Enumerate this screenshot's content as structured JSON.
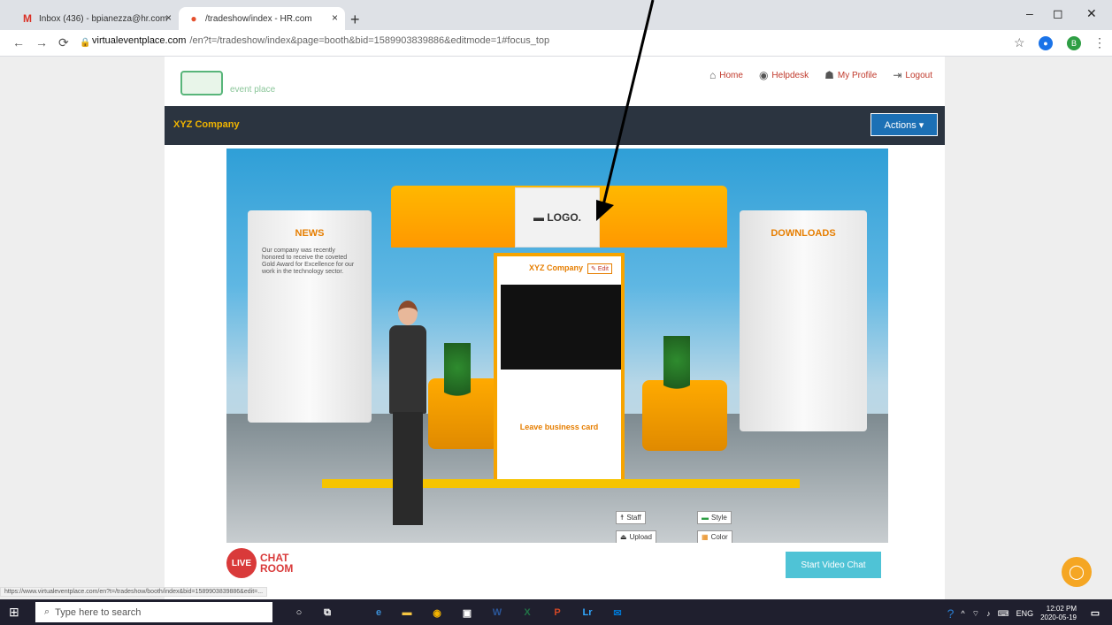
{
  "browser": {
    "tabs": [
      {
        "favicon": "M",
        "title": "Inbox (436) - bpianezza@hr.com",
        "close": "×"
      },
      {
        "favicon": "●",
        "title": "/tradeshow/index - HR.com",
        "close": "×"
      }
    ],
    "new_tab": "+",
    "window_controls": {
      "minimize": "–",
      "maximize": "◻",
      "close": "✕"
    },
    "url_host": "virtualeventplace.com",
    "url_path": "/en?t=/tradeshow/index&page=booth&bid=1589903839886&editmode=1#focus_top",
    "profile_initial": "B"
  },
  "site": {
    "logo_text": "event place",
    "nav": [
      {
        "icon": "home-icon",
        "label": "Home"
      },
      {
        "icon": "helpdesk-icon",
        "label": "Helpdesk"
      },
      {
        "icon": "profile-icon",
        "label": "My Profile"
      },
      {
        "icon": "logout-icon",
        "label": "Logout"
      }
    ],
    "company_name": "XYZ Company",
    "actions_label": "Actions ▾"
  },
  "booth": {
    "left_panel_title": "NEWS",
    "news_text": "Our company was recently honored to receive the coveted Gold Award for Excellence for our work in the technology sector.",
    "right_panel_title": "DOWNLOADS",
    "logo_text": "▬ LOGO.",
    "center_title": "XYZ Company",
    "edit_label": "Edit",
    "leave_card": "Leave business card",
    "tools": {
      "staff": "Staff",
      "upload": "Upload",
      "style": "Style",
      "color": "Color"
    }
  },
  "bottom": {
    "live_label": "LIVE",
    "chat_room": "CHAT ROOM",
    "video_chat": "Start Video Chat",
    "status_url": "https://www.virtualeventplace.com/en?t=/tradeshow/booth/index&bid=1589903839886&edit=..."
  },
  "taskbar": {
    "search_placeholder": "Type here to search",
    "language": "ENG",
    "time": "12:02 PM",
    "date": "2020-05-19"
  },
  "colors": {
    "accent": "#f0a000",
    "nav_bar": "#2b3440",
    "actions_button": "#1c70b5"
  }
}
